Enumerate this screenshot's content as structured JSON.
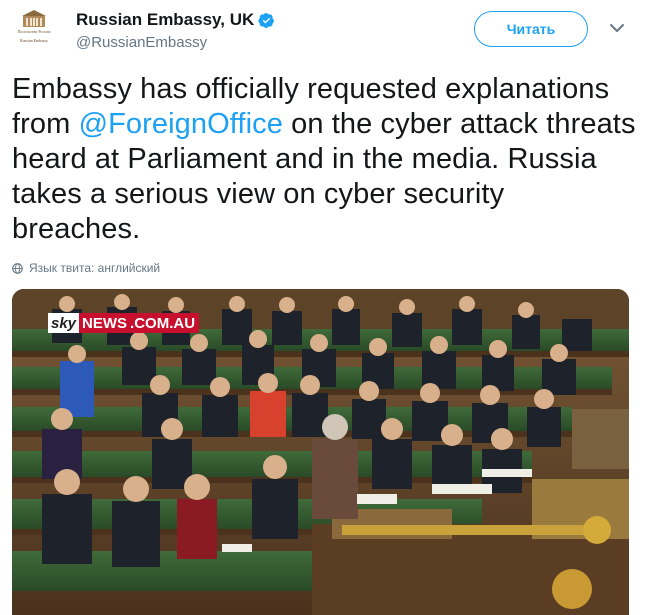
{
  "author": {
    "display_name": "Russian Embassy, UK",
    "handle": "@RussianEmbassy",
    "avatar_line1": "Посольство России",
    "avatar_line2": "Russian Embassy",
    "verified_icon": "verified-badge-icon"
  },
  "actions": {
    "follow_label": "Читать",
    "more_icon": "chevron-down-icon"
  },
  "tweet": {
    "text_before": "Embassy has officially requested explanations from ",
    "mention": "@ForeignOffice",
    "text_after": " on the cyber attack threats heard at Parliament and in the media. Russia takes a serious view on cyber security breaches.",
    "language_note": "Язык твита: английский",
    "globe_icon": "globe-icon"
  },
  "media": {
    "brand_sky": "sky",
    "brand_news": "NEWS",
    "brand_domain": ".COM.AU"
  },
  "colors": {
    "accent": "#1da1f2",
    "secondary_text": "#657786",
    "brand_red": "#c8102e"
  }
}
